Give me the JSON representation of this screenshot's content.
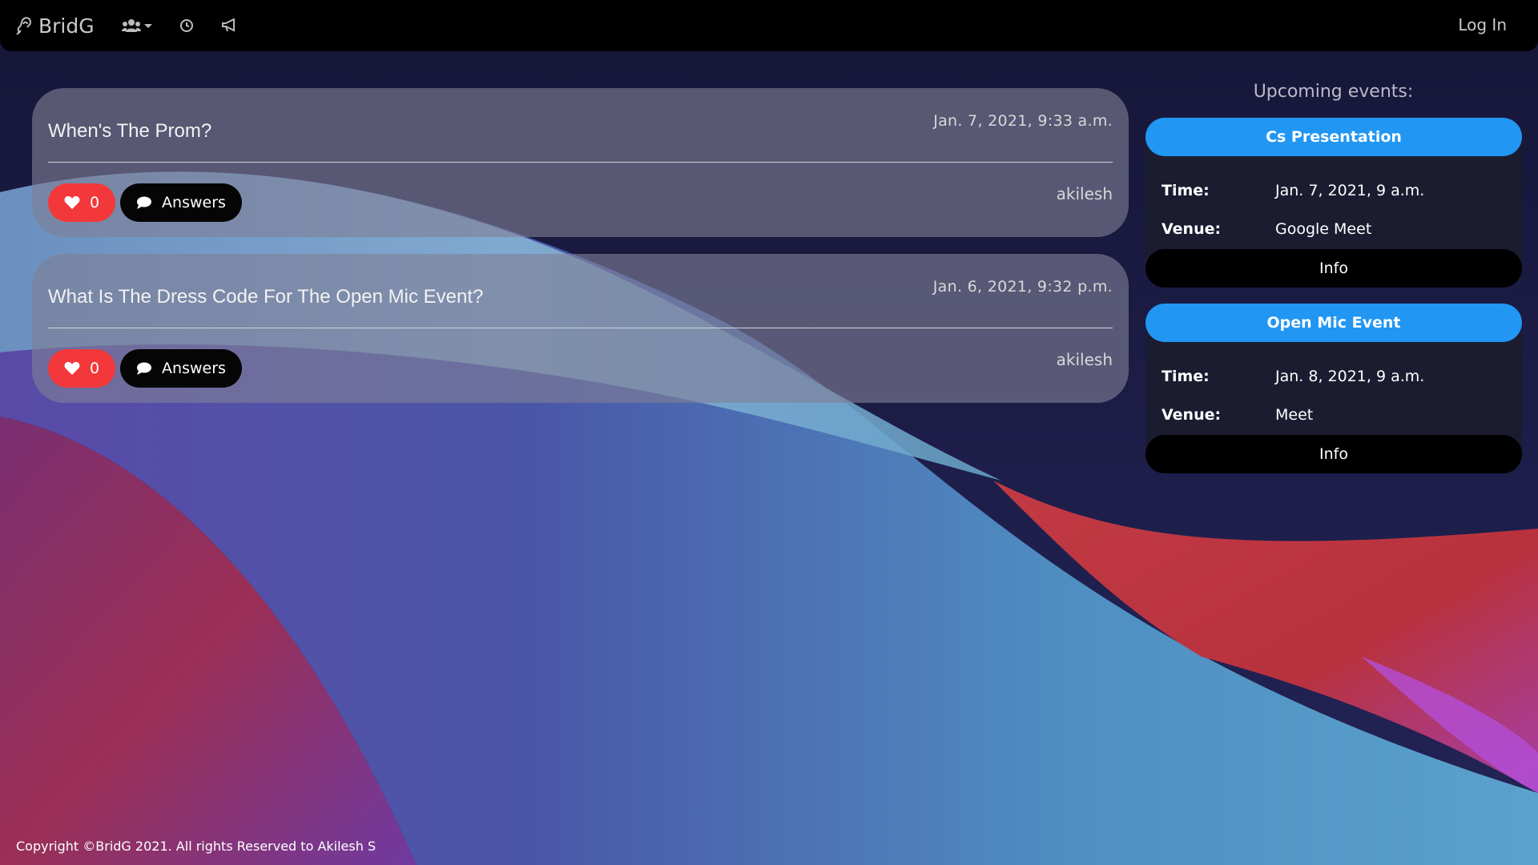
{
  "nav": {
    "brand": "BridG",
    "icons": [
      "ear-icon",
      "users-icon",
      "clock-icon",
      "bullhorn-icon"
    ],
    "login_label": "Log In"
  },
  "posts": [
    {
      "title": "When's The Prom?",
      "date": "Jan. 7, 2021, 9:33 a.m.",
      "author": "akilesh",
      "likes": "0",
      "answers_label": "Answers"
    },
    {
      "title": "What Is The Dress Code For The Open Mic Event?",
      "date": "Jan. 6, 2021, 9:32 p.m.",
      "author": "akilesh",
      "likes": "0",
      "answers_label": "Answers"
    }
  ],
  "sidebar": {
    "heading": "Upcoming events:",
    "events": [
      {
        "title": "Cs Presentation",
        "time_label": "Time:",
        "time": "Jan. 7, 2021, 9 a.m.",
        "venue_label": "Venue:",
        "venue": "Google Meet",
        "info_label": "Info"
      },
      {
        "title": "Open Mic Event",
        "time_label": "Time:",
        "time": "Jan. 8, 2021, 9 a.m.",
        "venue_label": "Venue:",
        "venue": "Meet",
        "info_label": "Info"
      }
    ]
  },
  "footer": {
    "copyright": "Copyright ©BridG 2021. All rights Reserved to Akilesh S"
  },
  "colors": {
    "like": "#f2383a",
    "event_title": "#2196f3",
    "navbar": "#000000"
  }
}
